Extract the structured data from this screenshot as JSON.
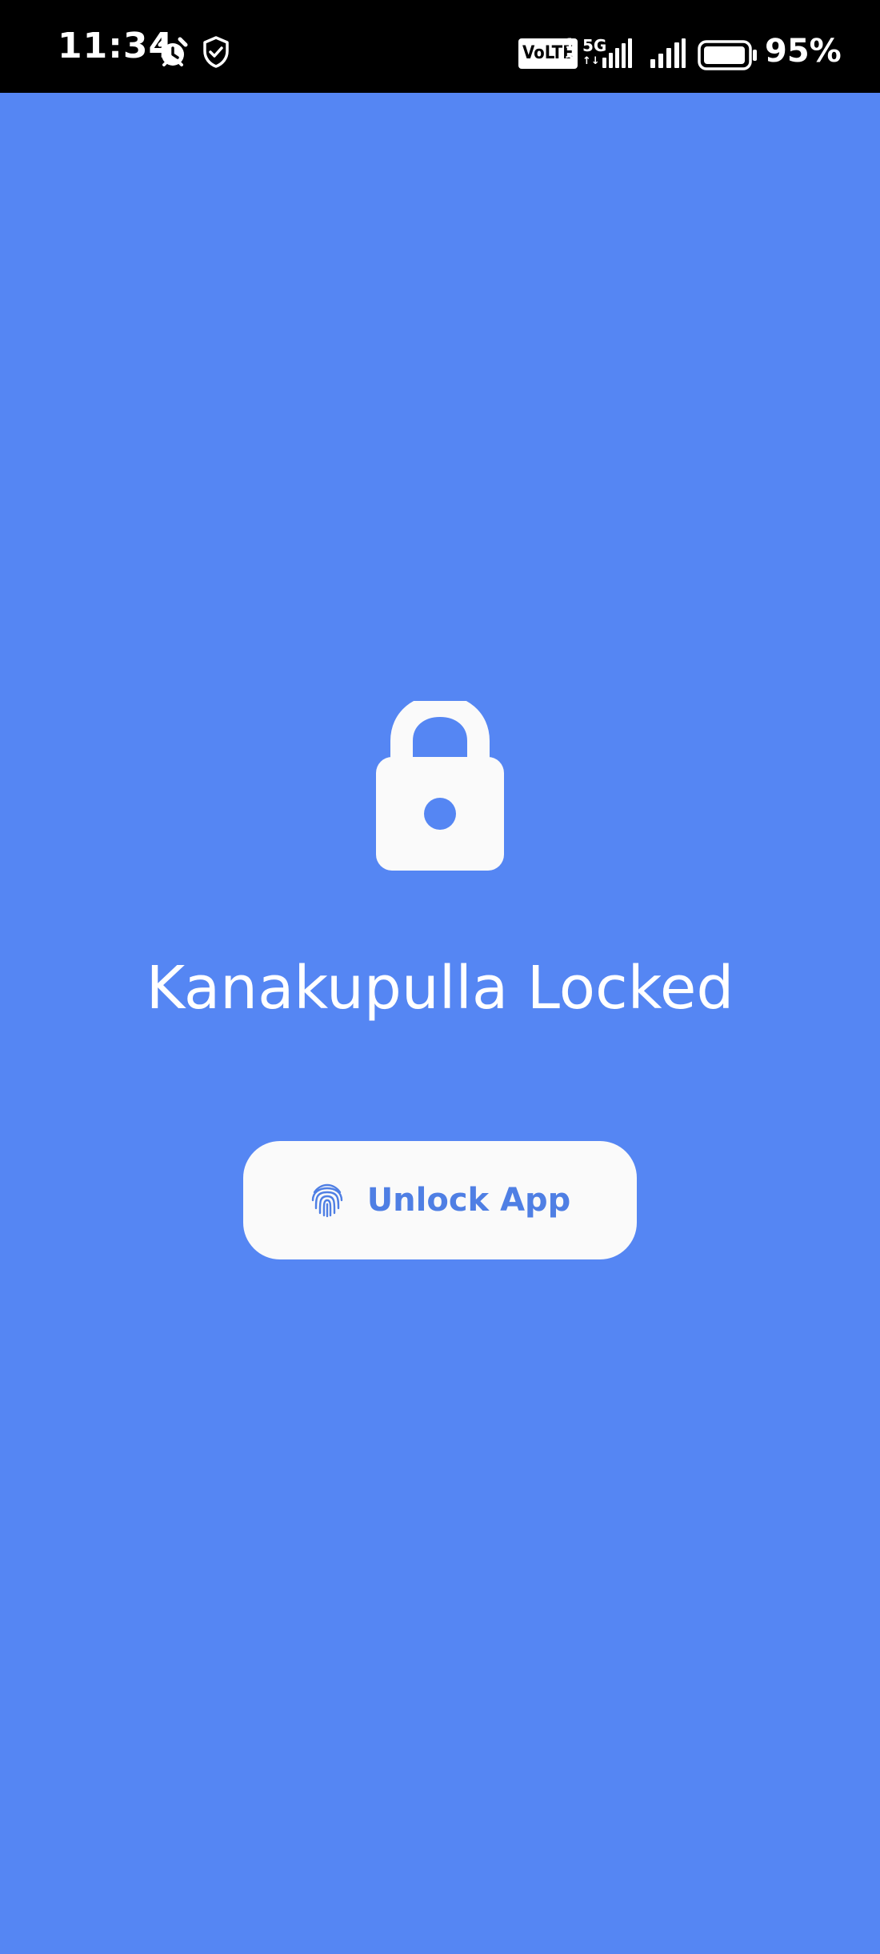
{
  "status_bar": {
    "time": "11:34",
    "volte": "VoLTE",
    "sim_top": "1",
    "sim_bottom": "2",
    "network": "5G",
    "network_arrows": "↑↓",
    "battery_percent": "95%",
    "battery_level": 0.95
  },
  "lock_screen": {
    "title": "Kanakupulla Locked",
    "unlock_label": "Unlock App"
  },
  "colors": {
    "background": "#5586F3",
    "button": "#FAFAFA",
    "accent": "#4F7FE4",
    "status_bar": "#000000"
  }
}
